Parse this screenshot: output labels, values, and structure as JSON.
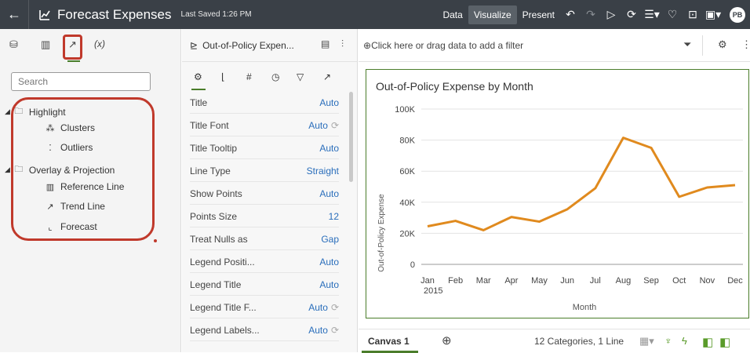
{
  "header": {
    "back_icon": "back-arrow-icon",
    "title": "Forecast Expenses",
    "saved": "Last Saved 1:26 PM",
    "modes": [
      "Data",
      "Visualize",
      "Present"
    ],
    "active_mode": "Visualize",
    "avatar": "PB"
  },
  "left_panel": {
    "tabs": {
      "fx": "(x)"
    },
    "search_placeholder": "Search",
    "groups": [
      {
        "label": "Highlight",
        "items": [
          "Clusters",
          "Outliers"
        ]
      },
      {
        "label": "Overlay & Projection",
        "items": [
          "Reference Line",
          "Trend Line",
          "Forecast"
        ]
      }
    ],
    "accent_color": "#c0392b"
  },
  "properties": {
    "viz_title": "Out-of-Policy Expen...",
    "rows": [
      {
        "name": "Title",
        "value": "Auto"
      },
      {
        "name": "Title Font",
        "value": "Auto"
      },
      {
        "name": "Title Tooltip",
        "value": "Auto"
      },
      {
        "name": "Line Type",
        "value": "Straight"
      },
      {
        "name": "Show Points",
        "value": "Auto"
      },
      {
        "name": "Points Size",
        "value": "12"
      },
      {
        "name": "Treat Nulls as",
        "value": "Gap"
      },
      {
        "name": "Legend Positi...",
        "value": "Auto"
      },
      {
        "name": "Legend Title",
        "value": "Auto"
      },
      {
        "name": "Legend Title F...",
        "value": "Auto"
      },
      {
        "name": "Legend Labels...",
        "value": "Auto"
      }
    ]
  },
  "canvas": {
    "filter_placeholder": "Click here or drag data to add a filter",
    "tab_label": "Canvas 1",
    "status": "12 Categories, 1 Line"
  },
  "chart_data": {
    "type": "line",
    "title": "Out-of-Policy Expense by Month",
    "xlabel": "Month",
    "ylabel": "Out-of-Policy Expense",
    "x_sublabel": "2015",
    "categories": [
      "Jan",
      "Feb",
      "Mar",
      "Apr",
      "May",
      "Jun",
      "Jul",
      "Aug",
      "Sep",
      "Oct",
      "Nov",
      "Dec"
    ],
    "y_ticks": [
      "0",
      "20K",
      "40K",
      "60K",
      "80K",
      "100K"
    ],
    "ylim": [
      0,
      100000
    ],
    "series": [
      {
        "color": "#e08a1e",
        "values": [
          24500,
          28000,
          22000,
          30500,
          27500,
          35500,
          49000,
          81500,
          75000,
          43500,
          49500,
          51000
        ]
      }
    ],
    "grid": true
  }
}
